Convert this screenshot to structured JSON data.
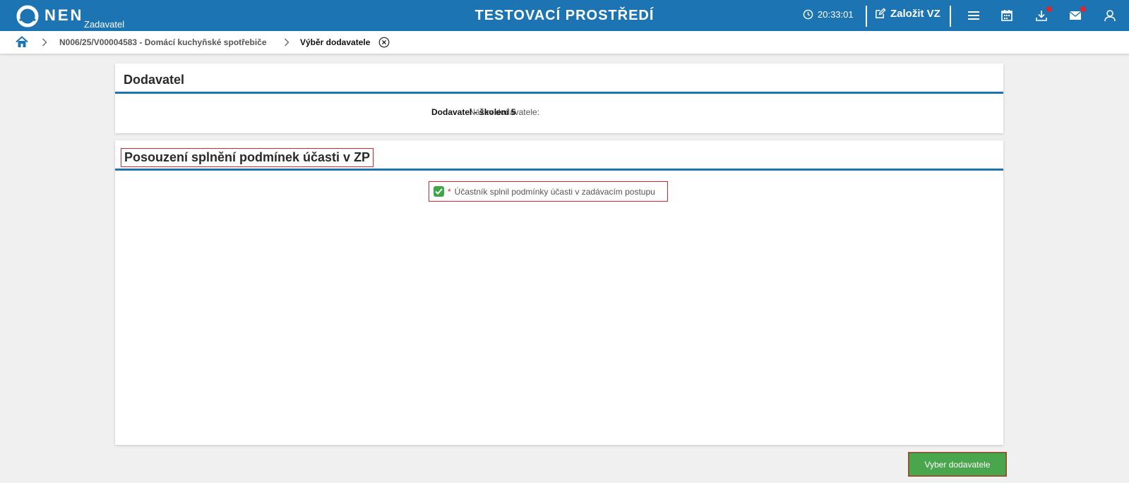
{
  "header": {
    "logo_text": "NEN",
    "logo_sub": "Zadavatel",
    "env_title": "TESTOVACÍ PROSTŘEDÍ",
    "clock": "20:33:01",
    "create_label": "Založit VZ",
    "icons": [
      "clock-icon",
      "edit-icon",
      "menu-icon",
      "calendar-icon",
      "download-icon",
      "mail-icon",
      "user-icon"
    ],
    "notification_color": "#e2232a",
    "bar_color": "#1c74b3"
  },
  "breadcrumb": {
    "link": "N006/25/V00004583 - Domácí kuchyňské spotřebiče",
    "current": "Výběr dodavatele"
  },
  "supplier_panel": {
    "title": "Dodavatel",
    "name_label": "Název dodavatele:",
    "name_value": "Dodavatel - školení 5"
  },
  "assessment_panel": {
    "title": "Posouzení splnění podmínek účasti v ZP",
    "checkbox_required_mark": "*",
    "checkbox_label": "Účastník splnil podmínky účasti v zadávacím postupu",
    "checkbox_checked": true
  },
  "actions": {
    "select_label": "Vyber dodavatele",
    "button_color": "#4aa64d"
  }
}
